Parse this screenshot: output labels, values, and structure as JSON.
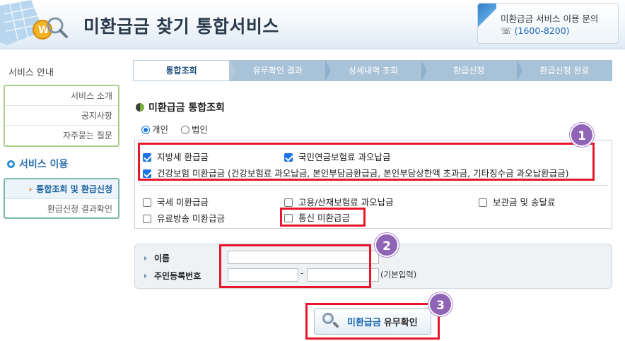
{
  "header": {
    "site_title": "미환급금 찾기 통합서비스",
    "contact_label": "미환급금 서비스 이용 문의",
    "contact_phone_icon": "phone-icon",
    "contact_phone": "(1600-8200)"
  },
  "sidebar": {
    "section1_title": "서비스 안내",
    "section1_items": [
      "서비스 소개",
      "공지사항",
      "자주묻는 질문"
    ],
    "section2_title": "서비스 이용",
    "section2_items": [
      {
        "label": "통합조회 및 환급신청",
        "active": true
      },
      {
        "label": "환급신청 결과확인",
        "active": false
      }
    ]
  },
  "steps": [
    "통합조회",
    "유무확인 결과",
    "상세내역 조회",
    "환급신청",
    "환급신청 완료"
  ],
  "main": {
    "section_title": "미환급금 통합조회",
    "radios": [
      {
        "label": "개인",
        "checked": true
      },
      {
        "label": "법인",
        "checked": false
      }
    ],
    "checks": [
      {
        "label": "지방세 환급금",
        "checked": true
      },
      {
        "label": "국민연금보험료 과오납금",
        "checked": true
      },
      {
        "label": "건강보험 미환급금 (건강보험료 과오납금, 본인부담금환급금, 본인부담상한액 초과금, 기타징수금 과오납환급금)",
        "checked": true
      },
      {
        "label": "국세 미환급금",
        "checked": false
      },
      {
        "label": "고용/산재보험료 과오납금",
        "checked": false
      },
      {
        "label": "보관금 및 송달료",
        "checked": false
      },
      {
        "label": "유료방송 미환급금",
        "checked": false
      },
      {
        "label": "통신 미환급금",
        "checked": false
      }
    ],
    "form": {
      "name_label": "이름",
      "name_value": "",
      "rrn_label": "주민등록번호",
      "rrn_front_value": "",
      "rrn_dash": "-",
      "rrn_back_value": "",
      "rrn_hint": "(기본입력)"
    },
    "submit": {
      "label_part1": "미환급금",
      "label_part2": "유무확인"
    }
  },
  "annotations": {
    "badges": [
      "1",
      "2",
      "3"
    ],
    "colors": {
      "box": "#e8162c",
      "badge": "#8f63b5"
    }
  }
}
